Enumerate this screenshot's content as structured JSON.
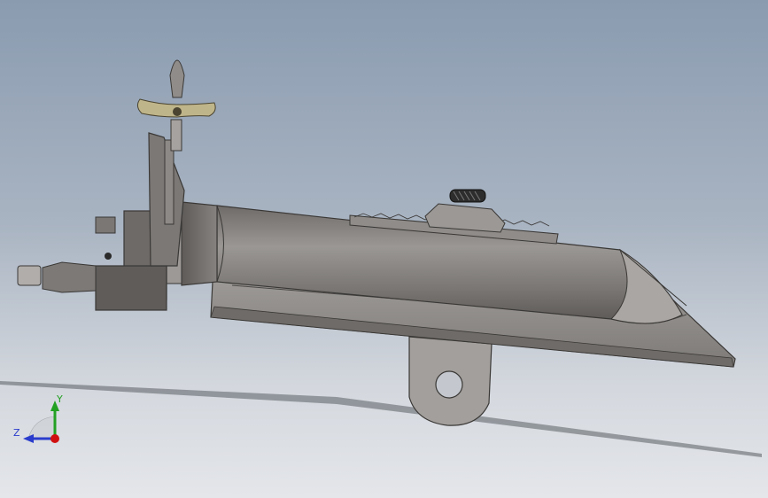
{
  "viewport": {
    "background_top": "#8a9bb0",
    "background_bottom": "#e4e6ea",
    "model_color": "#8d8a87",
    "handle_color": "#bfb58a"
  },
  "triad": {
    "y_label": "Y",
    "z_label": "Z",
    "y_color": "#22a022",
    "z_color": "#2a3ccc",
    "origin_color": "#d01010"
  }
}
